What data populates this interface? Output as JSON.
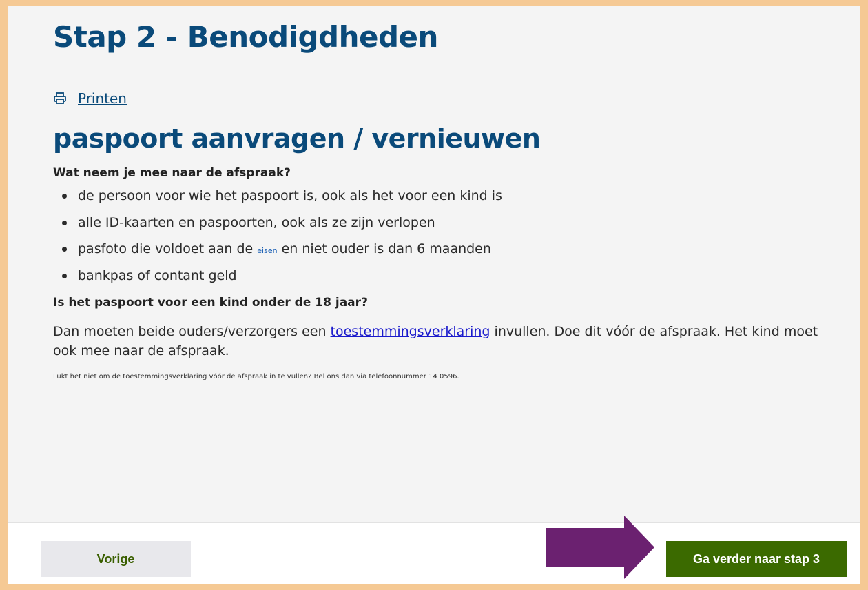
{
  "page": {
    "step_title": "Stap 2 - Benodigdheden",
    "print_label": "Printen",
    "section_title": "paspoort aanvragen / vernieuwen",
    "question_1": "Wat neem je mee naar de afspraak?",
    "list_items": [
      "de persoon voor wie het paspoort is, ook als het voor een kind is",
      "alle ID-kaarten en paspoorten, ook als ze zijn verlopen",
      {
        "before": "pasfoto die voldoet aan de ",
        "link": "eisen",
        "after": " en niet ouder is dan 6 maanden"
      },
      "bankpas of contant geld"
    ],
    "question_2": "Is het paspoort voor een kind onder de 18 jaar?",
    "paragraph": {
      "before": "Dan moeten beide ouders/verzorgers een ",
      "link": "toestemmingsverklaring",
      "after": " invullen. Doe dit vóór de afspraak. Het kind moet ook mee naar de afspraak."
    },
    "note": "Lukt het niet om de toestemmingsverklaring vóór de afspraak in te vullen? Bel ons dan via telefoonnummer 14 0596."
  },
  "footer": {
    "prev_label": "Vorige",
    "next_label": "Ga verder naar stap 3"
  },
  "icons": {
    "print": "printer-icon",
    "annotation": "arrow-right-icon"
  },
  "colors": {
    "heading": "#0a4a7a",
    "next_button": "#3b6a00",
    "annotation_arrow": "#6b2170",
    "frame_border": "#f5c994"
  }
}
